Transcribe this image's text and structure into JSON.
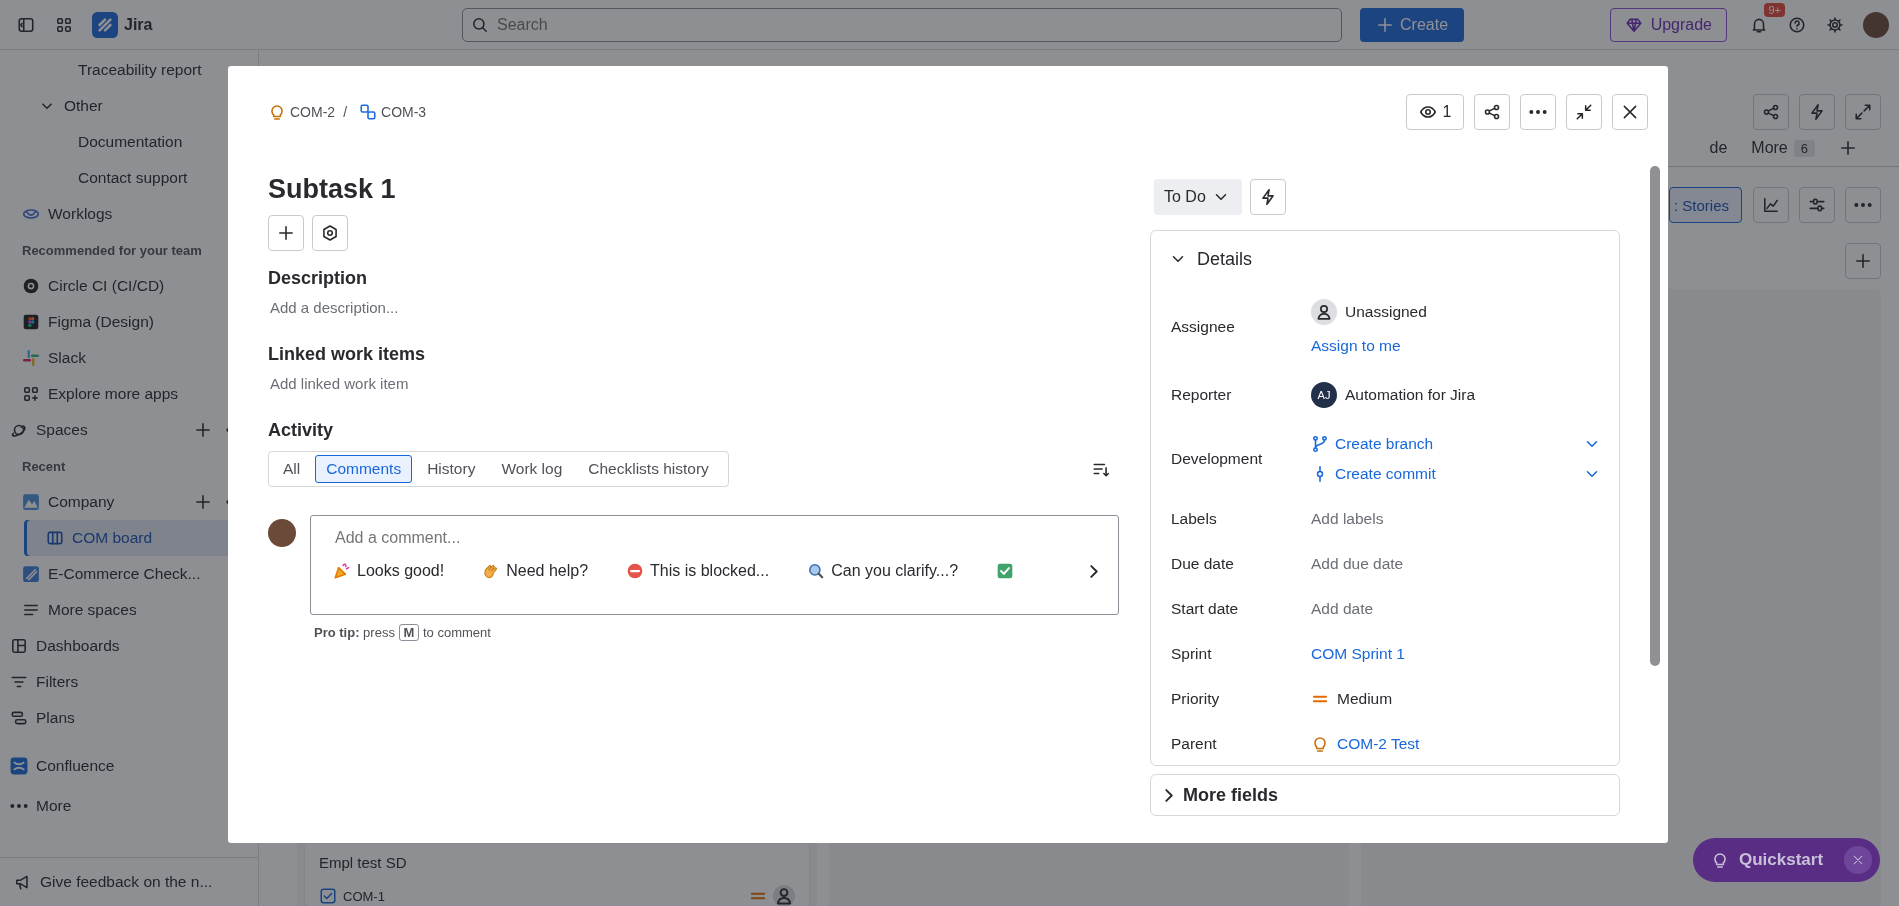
{
  "topbar": {
    "app_name": "Jira",
    "search": {
      "placeholder": "Search"
    },
    "create_label": "Create",
    "upgrade_label": "Upgrade",
    "notification_badge": "9+"
  },
  "sidebar": {
    "items": [
      {
        "kind": "child",
        "label": "Traceability report",
        "selected": false
      },
      {
        "kind": "group",
        "label": "Other",
        "selected": false,
        "expanded": true,
        "children": [
          {
            "label": "Documentation",
            "selected": false
          },
          {
            "label": "Contact support",
            "selected": false
          }
        ]
      },
      {
        "kind": "app",
        "label": "Worklogs",
        "selected": false
      },
      {
        "kind": "heading",
        "label": "Recommended for your team"
      },
      {
        "kind": "app",
        "label": "Circle CI (CI/CD)",
        "selected": false
      },
      {
        "kind": "app",
        "label": "Figma (Design)",
        "selected": false
      },
      {
        "kind": "app",
        "label": "Slack",
        "selected": false
      },
      {
        "kind": "app",
        "label": "Explore more apps",
        "selected": false
      },
      {
        "kind": "section",
        "label": "Spaces",
        "selected": false
      },
      {
        "kind": "heading",
        "label": "Recent"
      },
      {
        "kind": "space",
        "label": "Company",
        "selected": false,
        "children": [
          {
            "label": "COM board",
            "selected": true
          }
        ]
      },
      {
        "kind": "app",
        "label": "E-Commerce Check...",
        "selected": false
      },
      {
        "kind": "app-sub",
        "label": "More spaces",
        "selected": false
      },
      {
        "kind": "nav",
        "label": "Dashboards",
        "selected": false
      },
      {
        "kind": "nav",
        "label": "Filters",
        "selected": false
      },
      {
        "kind": "nav-sub",
        "label": "Plans",
        "selected": false
      },
      {
        "kind": "external",
        "label": "Confluence",
        "selected": false
      },
      {
        "kind": "nav",
        "label": "More",
        "selected": false
      }
    ],
    "feedback": "Give feedback on the n..."
  },
  "board": {
    "tabs": [
      {
        "label": "de",
        "selected": false
      },
      {
        "label": "More",
        "count": "6",
        "selected": false
      }
    ],
    "group_button": ": Stories",
    "card": {
      "title": "Empl test SD",
      "key": "COM-1"
    }
  },
  "modal": {
    "breadcrumbs": [
      {
        "label": "COM-2"
      },
      {
        "label": "COM-3"
      }
    ],
    "breadcrumb_separator": "/",
    "watchers": "1",
    "title": "Subtask 1",
    "description": {
      "heading": "Description",
      "placeholder": "Add a description..."
    },
    "linked": {
      "heading": "Linked work items",
      "placeholder": "Add linked work item"
    },
    "activity": {
      "heading": "Activity",
      "tabs": [
        {
          "label": "All",
          "selected": false
        },
        {
          "label": "Comments",
          "selected": true
        },
        {
          "label": "History",
          "selected": false
        },
        {
          "label": "Work log",
          "selected": false
        },
        {
          "label": "Checklists history",
          "selected": false
        }
      ],
      "comment": {
        "placeholder": "Add a comment...",
        "suggestions": [
          "Looks good!",
          "Need help?",
          "This is blocked...",
          "Can you clarify...?"
        ]
      },
      "pro_tip": {
        "before": "**Pro tip:** press",
        "key": "M",
        "after": "to comment"
      }
    },
    "status": "To Do",
    "details": {
      "heading": "Details",
      "expanded": true,
      "fields": [
        {
          "kind": "user",
          "label": "Assignee",
          "value": "Unassigned",
          "action": "Assign to me"
        },
        {
          "kind": "reporter",
          "label": "Reporter",
          "value": "Automation for Jira",
          "initials": "AJ"
        },
        {
          "kind": "dev",
          "label": "Development",
          "links": [
            "Create branch",
            "Create commit"
          ]
        },
        {
          "kind": "empty",
          "label": "Labels",
          "value": "Add labels"
        },
        {
          "kind": "empty",
          "label": "Due date",
          "value": "Add due date"
        },
        {
          "kind": "empty",
          "label": "Start date",
          "value": "Add date"
        },
        {
          "kind": "link",
          "label": "Sprint",
          "value": "COM Sprint 1"
        },
        {
          "kind": "priority",
          "label": "Priority",
          "value": "Medium"
        },
        {
          "kind": "parent",
          "label": "Parent",
          "value": "COM-2 Test"
        }
      ]
    },
    "more_fields": "More fields"
  },
  "quickstart": "Quickstart"
}
